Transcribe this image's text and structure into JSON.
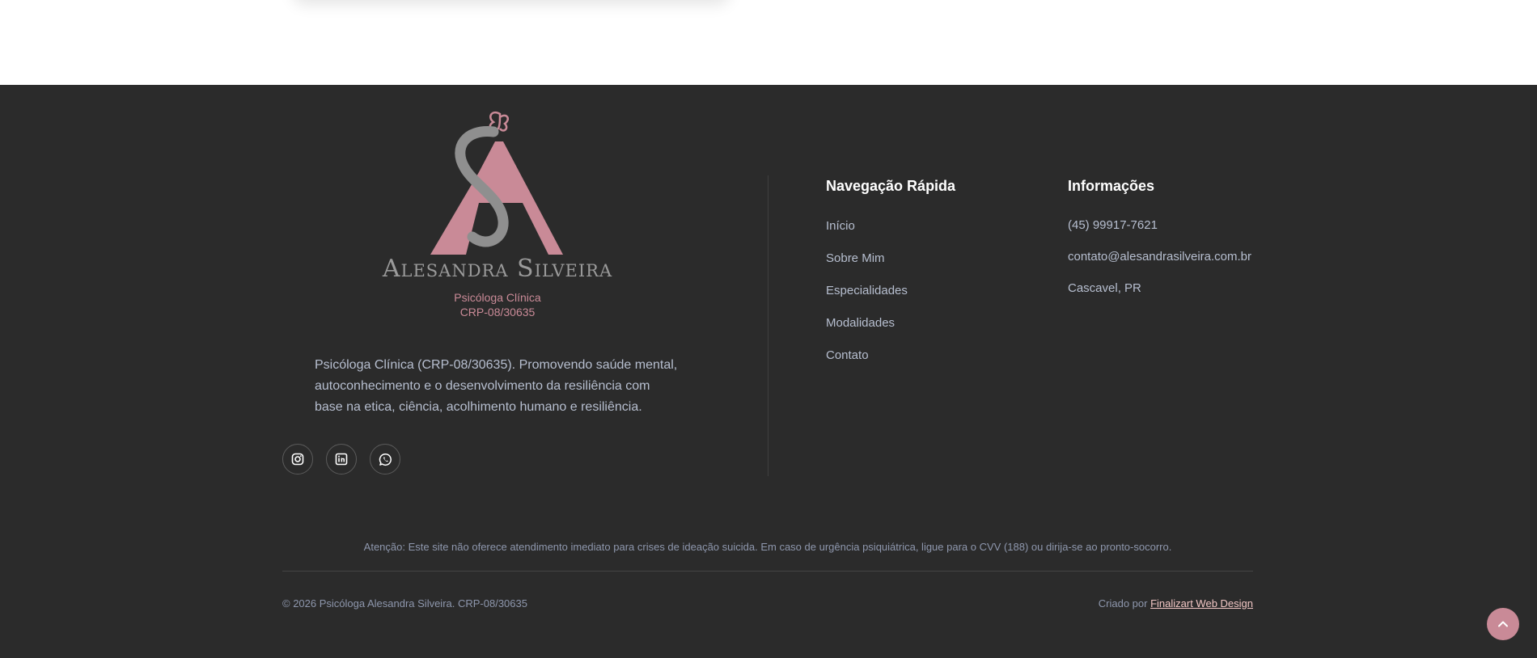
{
  "brand": {
    "name": "Alesandra Silveira",
    "subtitle": "Psicóloga Clínica",
    "registration": "CRP-08/30635"
  },
  "footer": {
    "description": "Psicóloga Clínica (CRP-08/30635). Promovendo saúde mental, autoconhecimento e o desenvolvimento da resiliência com base na etica, ciência, acolhimento humano e resiliência.",
    "socials": [
      {
        "icon": "instagram-icon"
      },
      {
        "icon": "linkedin-icon"
      },
      {
        "icon": "whatsapp-icon"
      }
    ],
    "nav": {
      "title": "Navegação Rápida",
      "items": [
        "Início",
        "Sobre Mim",
        "Especialidades",
        "Modalidades",
        "Contato"
      ]
    },
    "info": {
      "title": "Informações",
      "phone": "(45) 99917-7621",
      "email": "contato@alesandrasilveira.com.br",
      "location": "Cascavel, PR"
    },
    "warning": "Atenção: Este site não oferece atendimento imediato para crises de ideação suicida. Em caso de urgência psiquiátrica, ligue para o CVV (188) ou dirija-se ao pronto-socorro.",
    "copyright": "© 2026 Psicóloga Alesandra Silveira. CRP-08/30635",
    "credits_prefix": "Criado por",
    "credits_link": "Finalizart Web Design"
  },
  "colors": {
    "footer_bg": "#2b2b2b",
    "accent_pink": "#c98a97",
    "text_muted": "#b7bfd0",
    "link_pink": "#f2c7c5"
  },
  "back_to_top": {
    "icon": "chevron-up-icon"
  }
}
